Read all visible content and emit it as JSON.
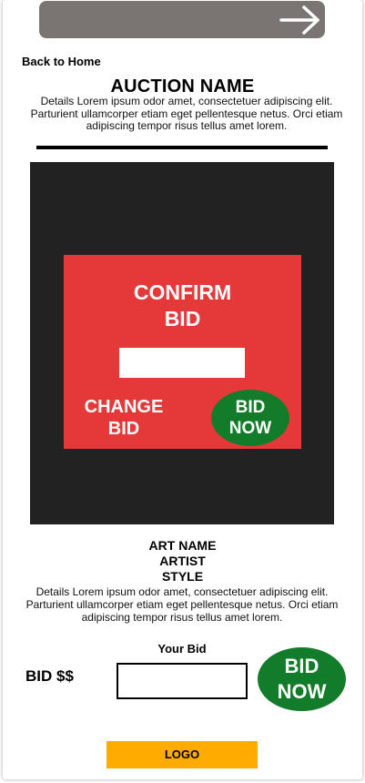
{
  "header": {
    "back_link": "Back to Home",
    "next_icon": "arrow-right-icon"
  },
  "auction": {
    "name": "AUCTION NAME",
    "details": "Details Lorem ipsum odor amet, consectetuer adipiscing elit. Parturient  ullamcorper etiam eget pellentesque netus. Orci etiam adipiscing tempor  risus tellus amet lorem."
  },
  "confirm_modal": {
    "title_line1": "CONFIRM",
    "title_line2": "BID",
    "input_value": "",
    "change_line1": "CHANGE",
    "change_line2": "BID",
    "bid_now_line1": "BID",
    "bid_now_line2": "NOW"
  },
  "art": {
    "name": "ART NAME",
    "artist": "ARTIST",
    "style": "STYLE",
    "details": "Details Lorem ipsum odor amet, consectetuer adipiscing elit. Parturient  ullamcorper etiam eget pellentesque netus. Orci etiam adipiscing tempor  risus tellus amet lorem."
  },
  "bid": {
    "your_bid_label": "Your Bid",
    "amount_label": "BID $$",
    "input_value": "",
    "bid_now_line1": "BID",
    "bid_now_line2": "NOW"
  },
  "footer": {
    "logo": "LOGO"
  },
  "colors": {
    "topbar": "#7a7473",
    "art_panel": "#222222",
    "modal": "#e53838",
    "bid_button": "#137c2b",
    "logo_bg": "#ffab00"
  }
}
